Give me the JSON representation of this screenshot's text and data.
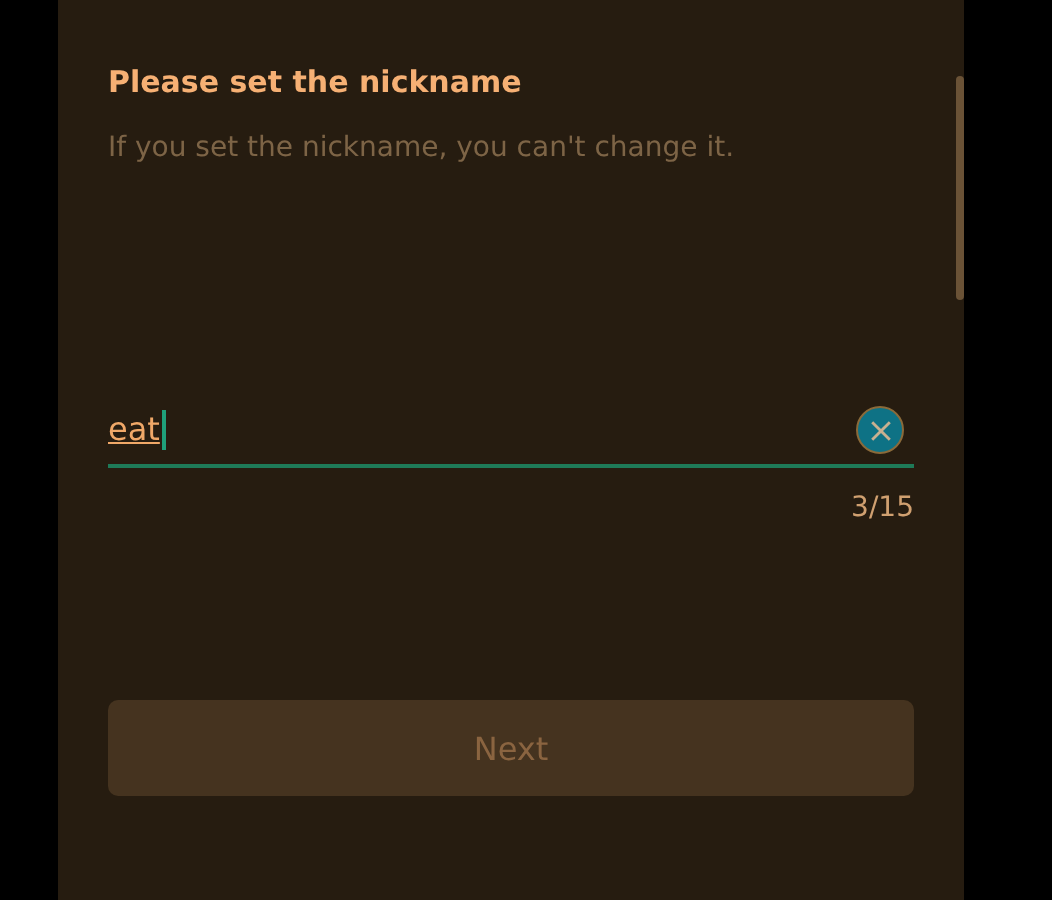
{
  "title": "Please set the nickname",
  "subtitle": "If you set the nickname, you can't change it.",
  "nickname_field": {
    "value": "eat",
    "focused": true
  },
  "counter": "3/15",
  "next_button": {
    "label": "Next",
    "disabled": true
  }
}
